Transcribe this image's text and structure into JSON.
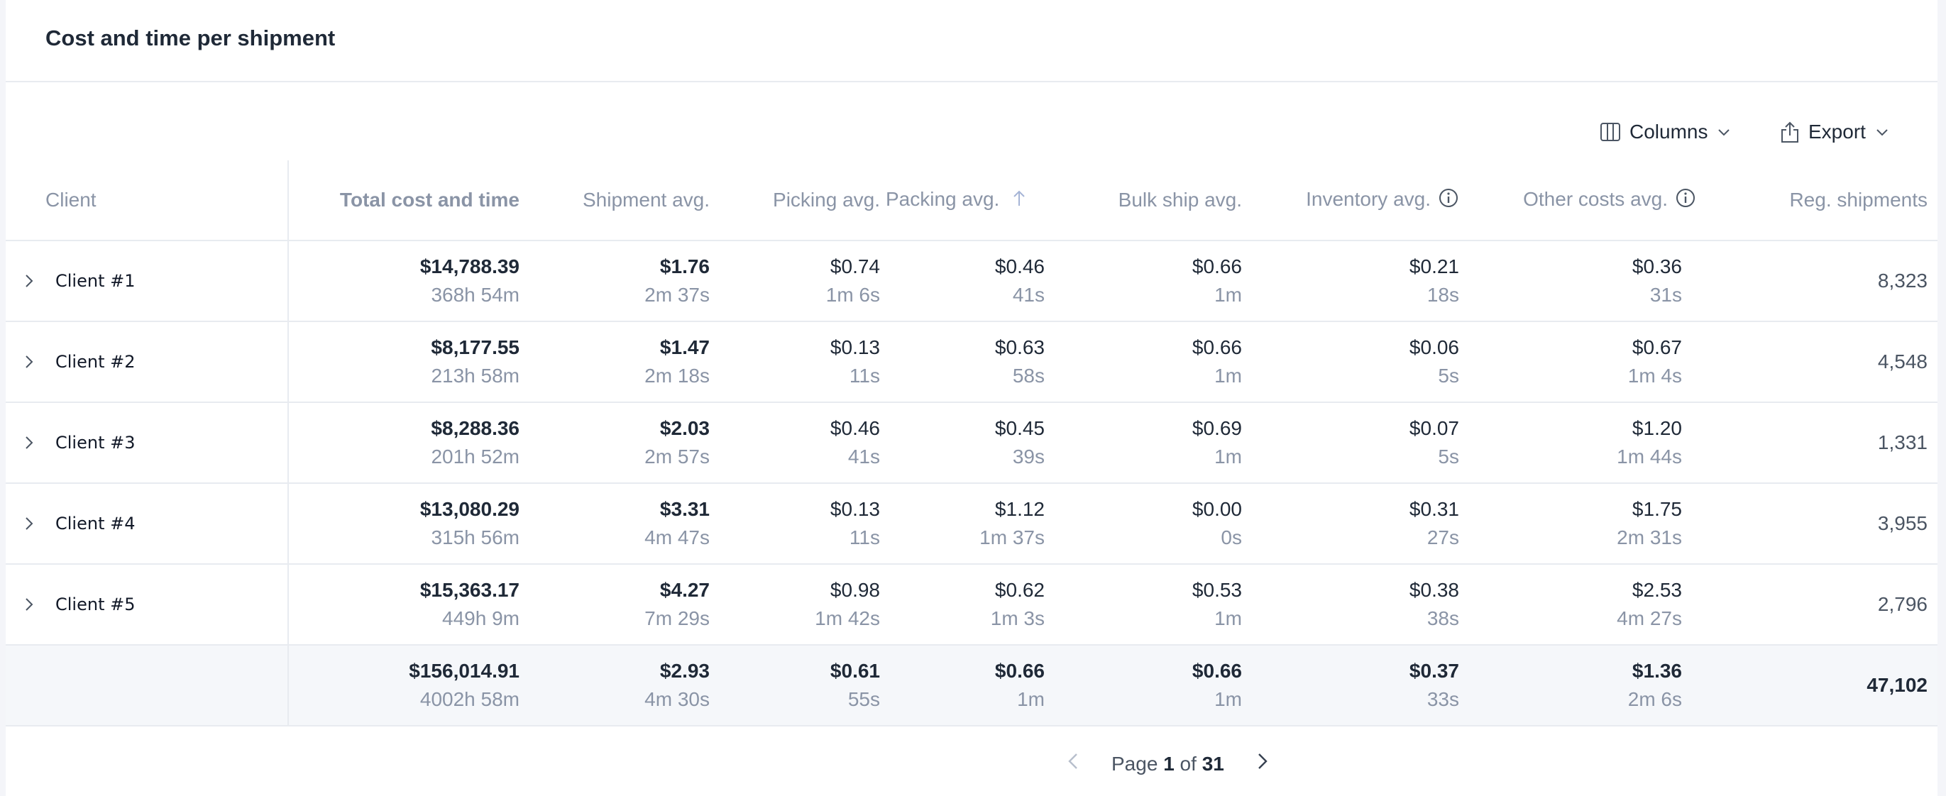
{
  "header": {
    "title": "Cost and time per shipment"
  },
  "toolbar": {
    "columns_label": "Columns",
    "export_label": "Export"
  },
  "table": {
    "columns": {
      "client": "Client",
      "total": "Total cost and time",
      "shipment": "Shipment avg.",
      "picking": "Picking avg.",
      "packing": "Packing avg.",
      "bulk": "Bulk ship avg.",
      "inventory": "Inventory avg.",
      "other": "Other costs avg.",
      "reg": "Reg. shipments"
    },
    "rows": [
      {
        "client": "Client #1",
        "total": [
          "$14,788.39",
          "368h 54m"
        ],
        "shipment": [
          "$1.76",
          "2m 37s"
        ],
        "picking": [
          "$0.74",
          "1m 6s"
        ],
        "packing": [
          "$0.46",
          "41s"
        ],
        "bulk": [
          "$0.66",
          "1m"
        ],
        "inventory": [
          "$0.21",
          "18s"
        ],
        "other": [
          "$0.36",
          "31s"
        ],
        "reg": "8,323"
      },
      {
        "client": "Client #2",
        "total": [
          "$8,177.55",
          "213h 58m"
        ],
        "shipment": [
          "$1.47",
          "2m 18s"
        ],
        "picking": [
          "$0.13",
          "11s"
        ],
        "packing": [
          "$0.63",
          "58s"
        ],
        "bulk": [
          "$0.66",
          "1m"
        ],
        "inventory": [
          "$0.06",
          "5s"
        ],
        "other": [
          "$0.67",
          "1m 4s"
        ],
        "reg": "4,548"
      },
      {
        "client": "Client #3",
        "total": [
          "$8,288.36",
          "201h 52m"
        ],
        "shipment": [
          "$2.03",
          "2m 57s"
        ],
        "picking": [
          "$0.46",
          "41s"
        ],
        "packing": [
          "$0.45",
          "39s"
        ],
        "bulk": [
          "$0.69",
          "1m"
        ],
        "inventory": [
          "$0.07",
          "5s"
        ],
        "other": [
          "$1.20",
          "1m 44s"
        ],
        "reg": "1,331"
      },
      {
        "client": "Client #4",
        "total": [
          "$13,080.29",
          "315h 56m"
        ],
        "shipment": [
          "$3.31",
          "4m 47s"
        ],
        "picking": [
          "$0.13",
          "11s"
        ],
        "packing": [
          "$1.12",
          "1m 37s"
        ],
        "bulk": [
          "$0.00",
          "0s"
        ],
        "inventory": [
          "$0.31",
          "27s"
        ],
        "other": [
          "$1.75",
          "2m 31s"
        ],
        "reg": "3,955"
      },
      {
        "client": "Client #5",
        "total": [
          "$15,363.17",
          "449h 9m"
        ],
        "shipment": [
          "$4.27",
          "7m 29s"
        ],
        "picking": [
          "$0.98",
          "1m 42s"
        ],
        "packing": [
          "$0.62",
          "1m 3s"
        ],
        "bulk": [
          "$0.53",
          "1m"
        ],
        "inventory": [
          "$0.38",
          "38s"
        ],
        "other": [
          "$2.53",
          "4m 27s"
        ],
        "reg": "2,796"
      }
    ],
    "totals": {
      "total": [
        "$156,014.91",
        "4002h 58m"
      ],
      "shipment": [
        "$2.93",
        "4m 30s"
      ],
      "picking": [
        "$0.61",
        "55s"
      ],
      "packing": [
        "$0.66",
        "1m"
      ],
      "bulk": [
        "$0.66",
        "1m"
      ],
      "inventory": [
        "$0.37",
        "33s"
      ],
      "other": [
        "$1.36",
        "2m 6s"
      ],
      "reg": "47,102"
    }
  },
  "pagination": {
    "prefix": "Page",
    "current": "1",
    "sep": "of",
    "total": "31"
  },
  "icons": {
    "columns": "columns-icon",
    "export": "share-export-icon",
    "dropdown": "chevron-down-icon",
    "expand": "chevron-right-icon",
    "sort": "arrow-up-icon",
    "info": "info-circle-icon",
    "prev": "chevron-left-icon",
    "next": "chevron-right-icon"
  },
  "colors": {
    "text": "#1f2937",
    "muted": "#8a94a6",
    "border": "#e8ebf0",
    "totals_bg": "#f5f7fa",
    "sort_arrow": "#a5b4d6"
  }
}
